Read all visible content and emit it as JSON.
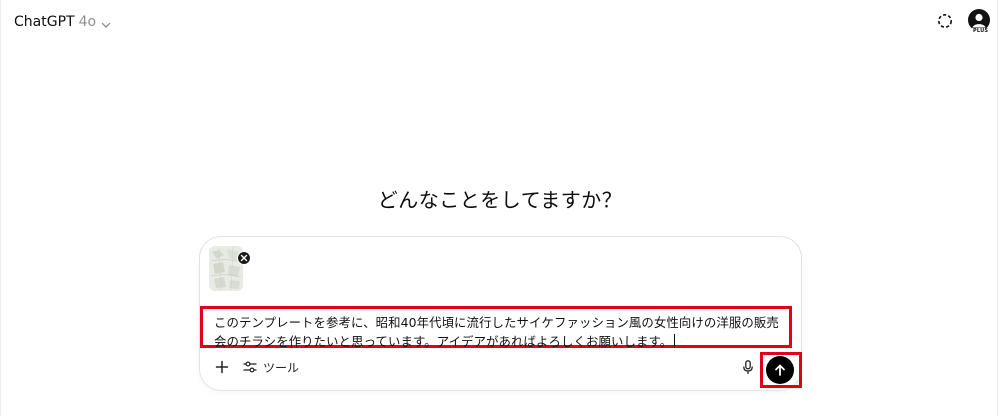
{
  "header": {
    "model_name": "ChatGPT",
    "model_version": "4o",
    "plan_badge": "PLUS"
  },
  "main": {
    "heading": "どんなことをしてますか？"
  },
  "composer": {
    "prompt_text": "このテンプレートを参考に、昭和40年代頃に流行したサイケファッション風の女性向けの洋服の販売会のチラシを作りたいと思っています。アイデアがあればよろしくお願いします。",
    "tools_label": "ツール"
  },
  "icons": {
    "model_chevron": "chevron-down-icon",
    "temp_chat": "dashed-circle-icon",
    "avatar": "user-avatar-icon",
    "remove_attachment": "close-icon",
    "add": "plus-icon",
    "tools": "sliders-icon",
    "mic": "microphone-icon",
    "send": "arrow-up-icon"
  },
  "colors": {
    "highlight": "#e0001a",
    "send_button": "#000000",
    "muted_text": "#8f8f8f"
  }
}
